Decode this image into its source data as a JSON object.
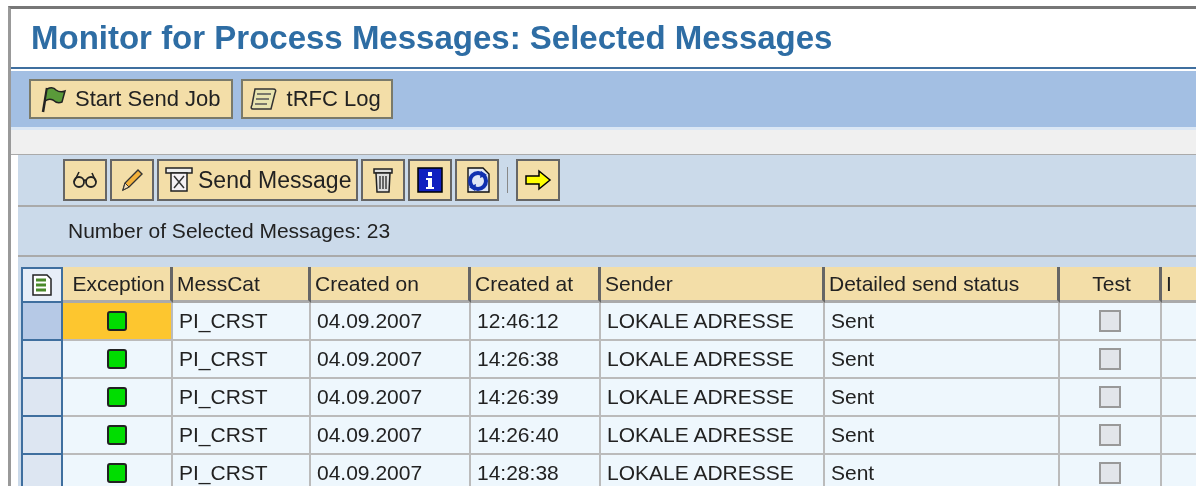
{
  "title": "Monitor for Process Messages: Selected Messages",
  "toolbar": [
    {
      "label": "Start Send Job"
    },
    {
      "label": "tRFC Log"
    }
  ],
  "grid_toolbar": [
    {
      "kind": "icon"
    },
    {
      "kind": "icon"
    },
    {
      "kind": "text",
      "label": "Send Message"
    },
    {
      "kind": "icon"
    },
    {
      "kind": "icon"
    },
    {
      "kind": "icon"
    },
    {
      "kind": "separator"
    },
    {
      "kind": "icon"
    }
  ],
  "count_text": "Number of Selected Messages: 23",
  "table": {
    "columns": [
      "Exception",
      "MessCat",
      "Created on",
      "Created at",
      "Sender",
      "Detailed send status",
      "Test",
      "I"
    ],
    "rows": [
      {
        "selected": true,
        "mess_cat": "PI_CRST",
        "created_on": "04.09.2007",
        "created_at": "12:46:12",
        "sender": "LOKALE ADRESSE",
        "status": "Sent",
        "test": false
      },
      {
        "selected": false,
        "mess_cat": "PI_CRST",
        "created_on": "04.09.2007",
        "created_at": "14:26:38",
        "sender": "LOKALE ADRESSE",
        "status": "Sent",
        "test": false
      },
      {
        "selected": false,
        "mess_cat": "PI_CRST",
        "created_on": "04.09.2007",
        "created_at": "14:26:39",
        "sender": "LOKALE ADRESSE",
        "status": "Sent",
        "test": false
      },
      {
        "selected": false,
        "mess_cat": "PI_CRST",
        "created_on": "04.09.2007",
        "created_at": "14:26:40",
        "sender": "LOKALE ADRESSE",
        "status": "Sent",
        "test": false
      },
      {
        "selected": false,
        "mess_cat": "PI_CRST",
        "created_on": "04.09.2007",
        "created_at": "14:28:38",
        "sender": "LOKALE ADRESSE",
        "status": "Sent",
        "test": false
      }
    ]
  }
}
